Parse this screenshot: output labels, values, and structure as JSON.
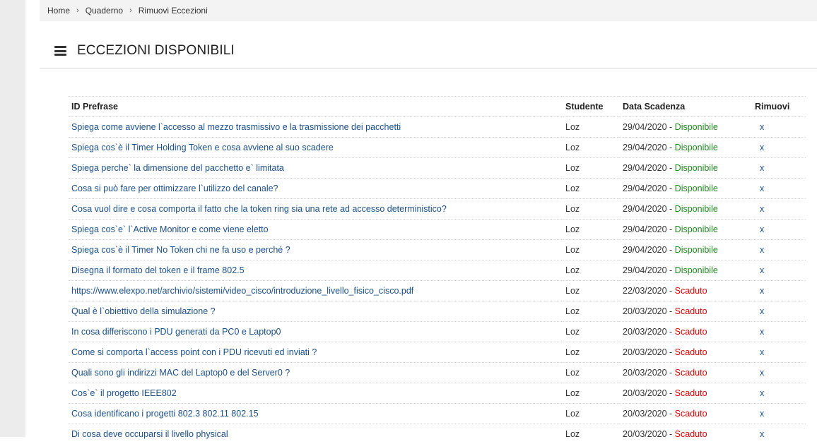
{
  "breadcrumb": [
    "Home",
    "Quaderno",
    "Rimuovi Eccezioni"
  ],
  "page_title": "ECCEZIONI DISPONIBILI",
  "table": {
    "columns": [
      "ID Prefrase",
      "Studente",
      "Data Scadenza",
      "Rimuovi"
    ],
    "rows": [
      {
        "question": "Spiega come avviene l`accesso al mezzo trasmissivo e la trasmissione dei pacchetti",
        "student": "Loz",
        "date": "29/04/2020",
        "status": "Disponibile",
        "remove": "x"
      },
      {
        "question": "Spiega cos`è il Timer Holding Token e cosa avviene al suo scadere",
        "student": "Loz",
        "date": "29/04/2020",
        "status": "Disponibile",
        "remove": "x"
      },
      {
        "question": "Spiega perche` la dimensione del pacchetto e` limitata",
        "student": "Loz",
        "date": "29/04/2020",
        "status": "Disponibile",
        "remove": "x"
      },
      {
        "question": "Cosa si può fare per ottimizzare l`utilizzo del canale?",
        "student": "Loz",
        "date": "29/04/2020",
        "status": "Disponibile",
        "remove": "x"
      },
      {
        "question": "Cosa vuol dire e cosa comporta il fatto che la token ring sia una rete ad accesso deterministico?",
        "student": "Loz",
        "date": "29/04/2020",
        "status": "Disponibile",
        "remove": "x"
      },
      {
        "question": "Spiega cos`e` l`Active Monitor e come viene eletto",
        "student": "Loz",
        "date": "29/04/2020",
        "status": "Disponibile",
        "remove": "x"
      },
      {
        "question": "Spiega cos`è il Timer No Token chi ne fa uso e perché ?",
        "student": "Loz",
        "date": "29/04/2020",
        "status": "Disponibile",
        "remove": "x"
      },
      {
        "question": "Disegna il formato del token e il frame 802.5",
        "student": "Loz",
        "date": "29/04/2020",
        "status": "Disponibile",
        "remove": "x"
      },
      {
        "question": "https://www.elexpo.net/archivio/sistemi/video_cisco/introduzione_livello_fisico_cisco.pdf",
        "student": "Loz",
        "date": "22/03/2020",
        "status": "Scaduto",
        "remove": "x"
      },
      {
        "question": "Qual è l`obiettivo della simulazione ?",
        "student": "Loz",
        "date": "20/03/2020",
        "status": "Scaduto",
        "remove": "x"
      },
      {
        "question": "In cosa differiscono i PDU generati da PC0 e Laptop0",
        "student": "Loz",
        "date": "20/03/2020",
        "status": "Scaduto",
        "remove": "x"
      },
      {
        "question": "Come si comporta l`access point con i PDU ricevuti ed inviati ?",
        "student": "Loz",
        "date": "20/03/2020",
        "status": "Scaduto",
        "remove": "x"
      },
      {
        "question": "Quali sono gli indirizzi MAC del Laptop0 e del Server0 ?",
        "student": "Loz",
        "date": "20/03/2020",
        "status": "Scaduto",
        "remove": "x"
      },
      {
        "question": "Cos`e` il progetto IEEE802",
        "student": "Loz",
        "date": "20/03/2020",
        "status": "Scaduto",
        "remove": "x"
      },
      {
        "question": "Cosa identificano i progetti 802.3 802.11 802.15",
        "student": "Loz",
        "date": "20/03/2020",
        "status": "Scaduto",
        "remove": "x"
      },
      {
        "question": "Di cosa deve occuparsi il livello physical",
        "student": "Loz",
        "date": "20/03/2020",
        "status": "Scaduto",
        "remove": "x"
      }
    ]
  },
  "status_colors": {
    "Disponibile": "#1e8a1e",
    "Scaduto": "#e00000"
  },
  "icons": {
    "menu": "hamburger-menu-icon",
    "separator": "chevron-right-icon"
  }
}
